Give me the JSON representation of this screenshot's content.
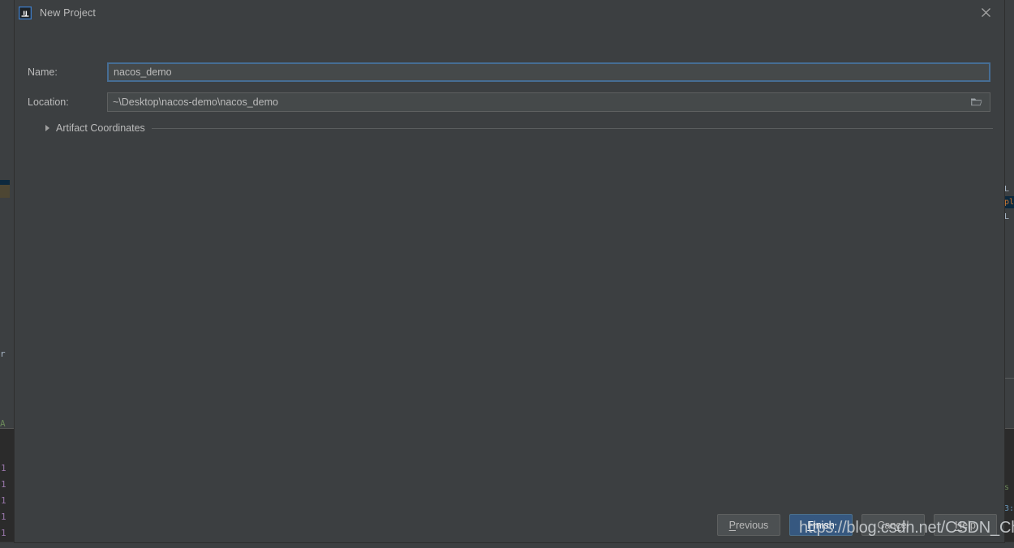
{
  "window": {
    "title": "New Project",
    "app_icon": "intellij-idea-icon",
    "close_icon": "close-icon"
  },
  "form": {
    "name": {
      "label": "Name:",
      "value": "nacos_demo",
      "placeholder": "",
      "focused": true
    },
    "location": {
      "label": "Location:",
      "value": "~\\Desktop\\nacos-demo\\nacos_demo",
      "placeholder": "",
      "browse_icon": "folder-open-icon"
    },
    "artifact_coordinates": {
      "label": "Artifact Coordinates",
      "expanded": false,
      "chevron_icon": "triangle-right-icon"
    }
  },
  "buttons": {
    "previous": {
      "label": "Previous",
      "mnemonic": "P"
    },
    "finish": {
      "label": "Finish",
      "mnemonic": "F",
      "default": true
    },
    "cancel": {
      "label": "Cancel",
      "mnemonic": "C"
    },
    "help": {
      "label": "Help",
      "mnemonic": "H"
    }
  },
  "watermark": {
    "text": "https://blog.csdn.net/CSDN_ChenF"
  },
  "background": {
    "gutter_numbers": [
      "1",
      "1",
      "1",
      "1",
      "1"
    ],
    "fragments": [
      "r",
      "A"
    ],
    "right_fragments": [
      "L",
      "pl",
      "L",
      "s",
      "3:"
    ]
  },
  "colors": {
    "dialog_bg": "#3c3f41",
    "input_bg": "#45494a",
    "focus_border": "#466d94",
    "default_button": "#365880",
    "text": "#bbbbbb",
    "editor_bg": "#2b2b2b",
    "selection": "#0d293e",
    "gutter_number": "#9876aa"
  }
}
